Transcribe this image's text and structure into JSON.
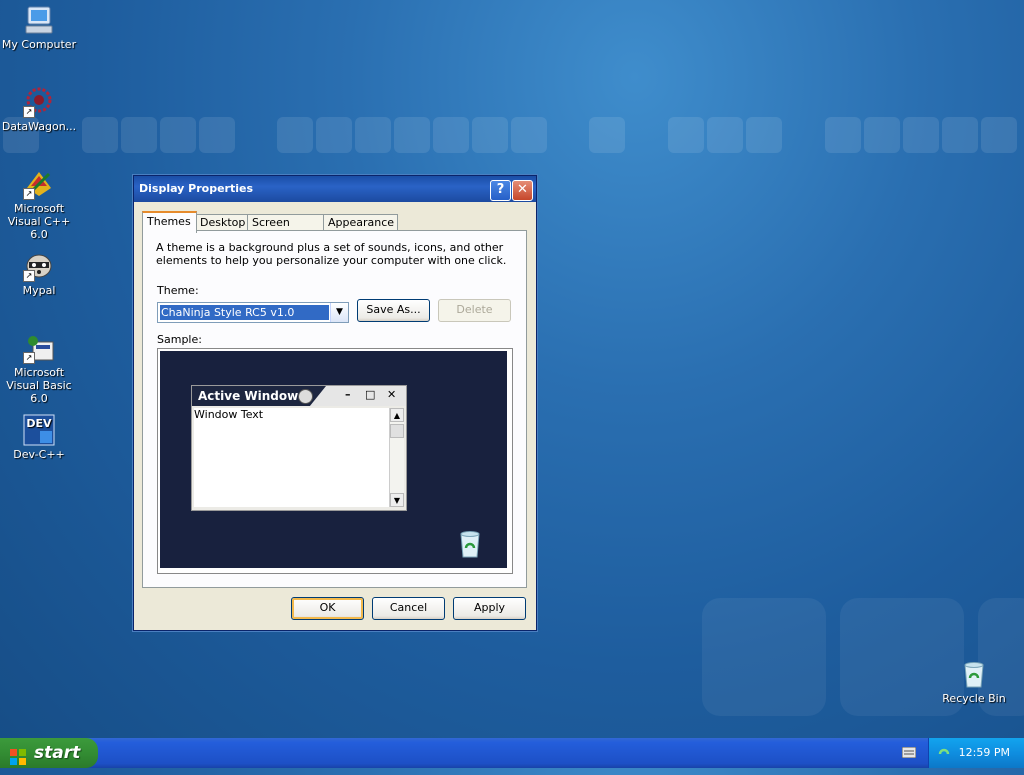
{
  "desktop": {
    "icons": [
      {
        "label": "My Computer"
      },
      {
        "label": "DataWagon..."
      },
      {
        "label": "Microsoft Visual C++ 6.0"
      },
      {
        "label": "Mypal"
      },
      {
        "label": "Microsoft Visual Basic 6.0"
      },
      {
        "label": "Dev-C++"
      },
      {
        "label": "Recycle Bin"
      }
    ],
    "dev_badge": "DEV"
  },
  "dialog": {
    "title": "Display Properties",
    "help_label": "?",
    "close_label": "✕",
    "tabs": [
      {
        "label": "Themes",
        "active": true
      },
      {
        "label": "Desktop",
        "active": false
      },
      {
        "label": "Screen Saver",
        "active": false
      },
      {
        "label": "Appearance",
        "active": false
      }
    ],
    "description": "A theme is a background plus a set of sounds, icons, and other elements to help you personalize your computer with one click.",
    "theme_label": "Theme:",
    "theme_value": "ChaNinja Style RC5 v1.0",
    "save_as_label": "Save As...",
    "delete_label": "Delete",
    "sample_label": "Sample:",
    "sample": {
      "window_title": "Active Window",
      "window_text": "Window Text",
      "min": "–",
      "max": "□",
      "close": "✕"
    },
    "ok_label": "OK",
    "cancel_label": "Cancel",
    "apply_label": "Apply"
  },
  "taskbar": {
    "start_label": "start",
    "clock": "12:59 PM"
  },
  "colors": {
    "desktop_blue": "#1e5d9e",
    "title_blue": "#2a63c6",
    "start_green": "#338d33",
    "sample_dark": "#18213e"
  }
}
